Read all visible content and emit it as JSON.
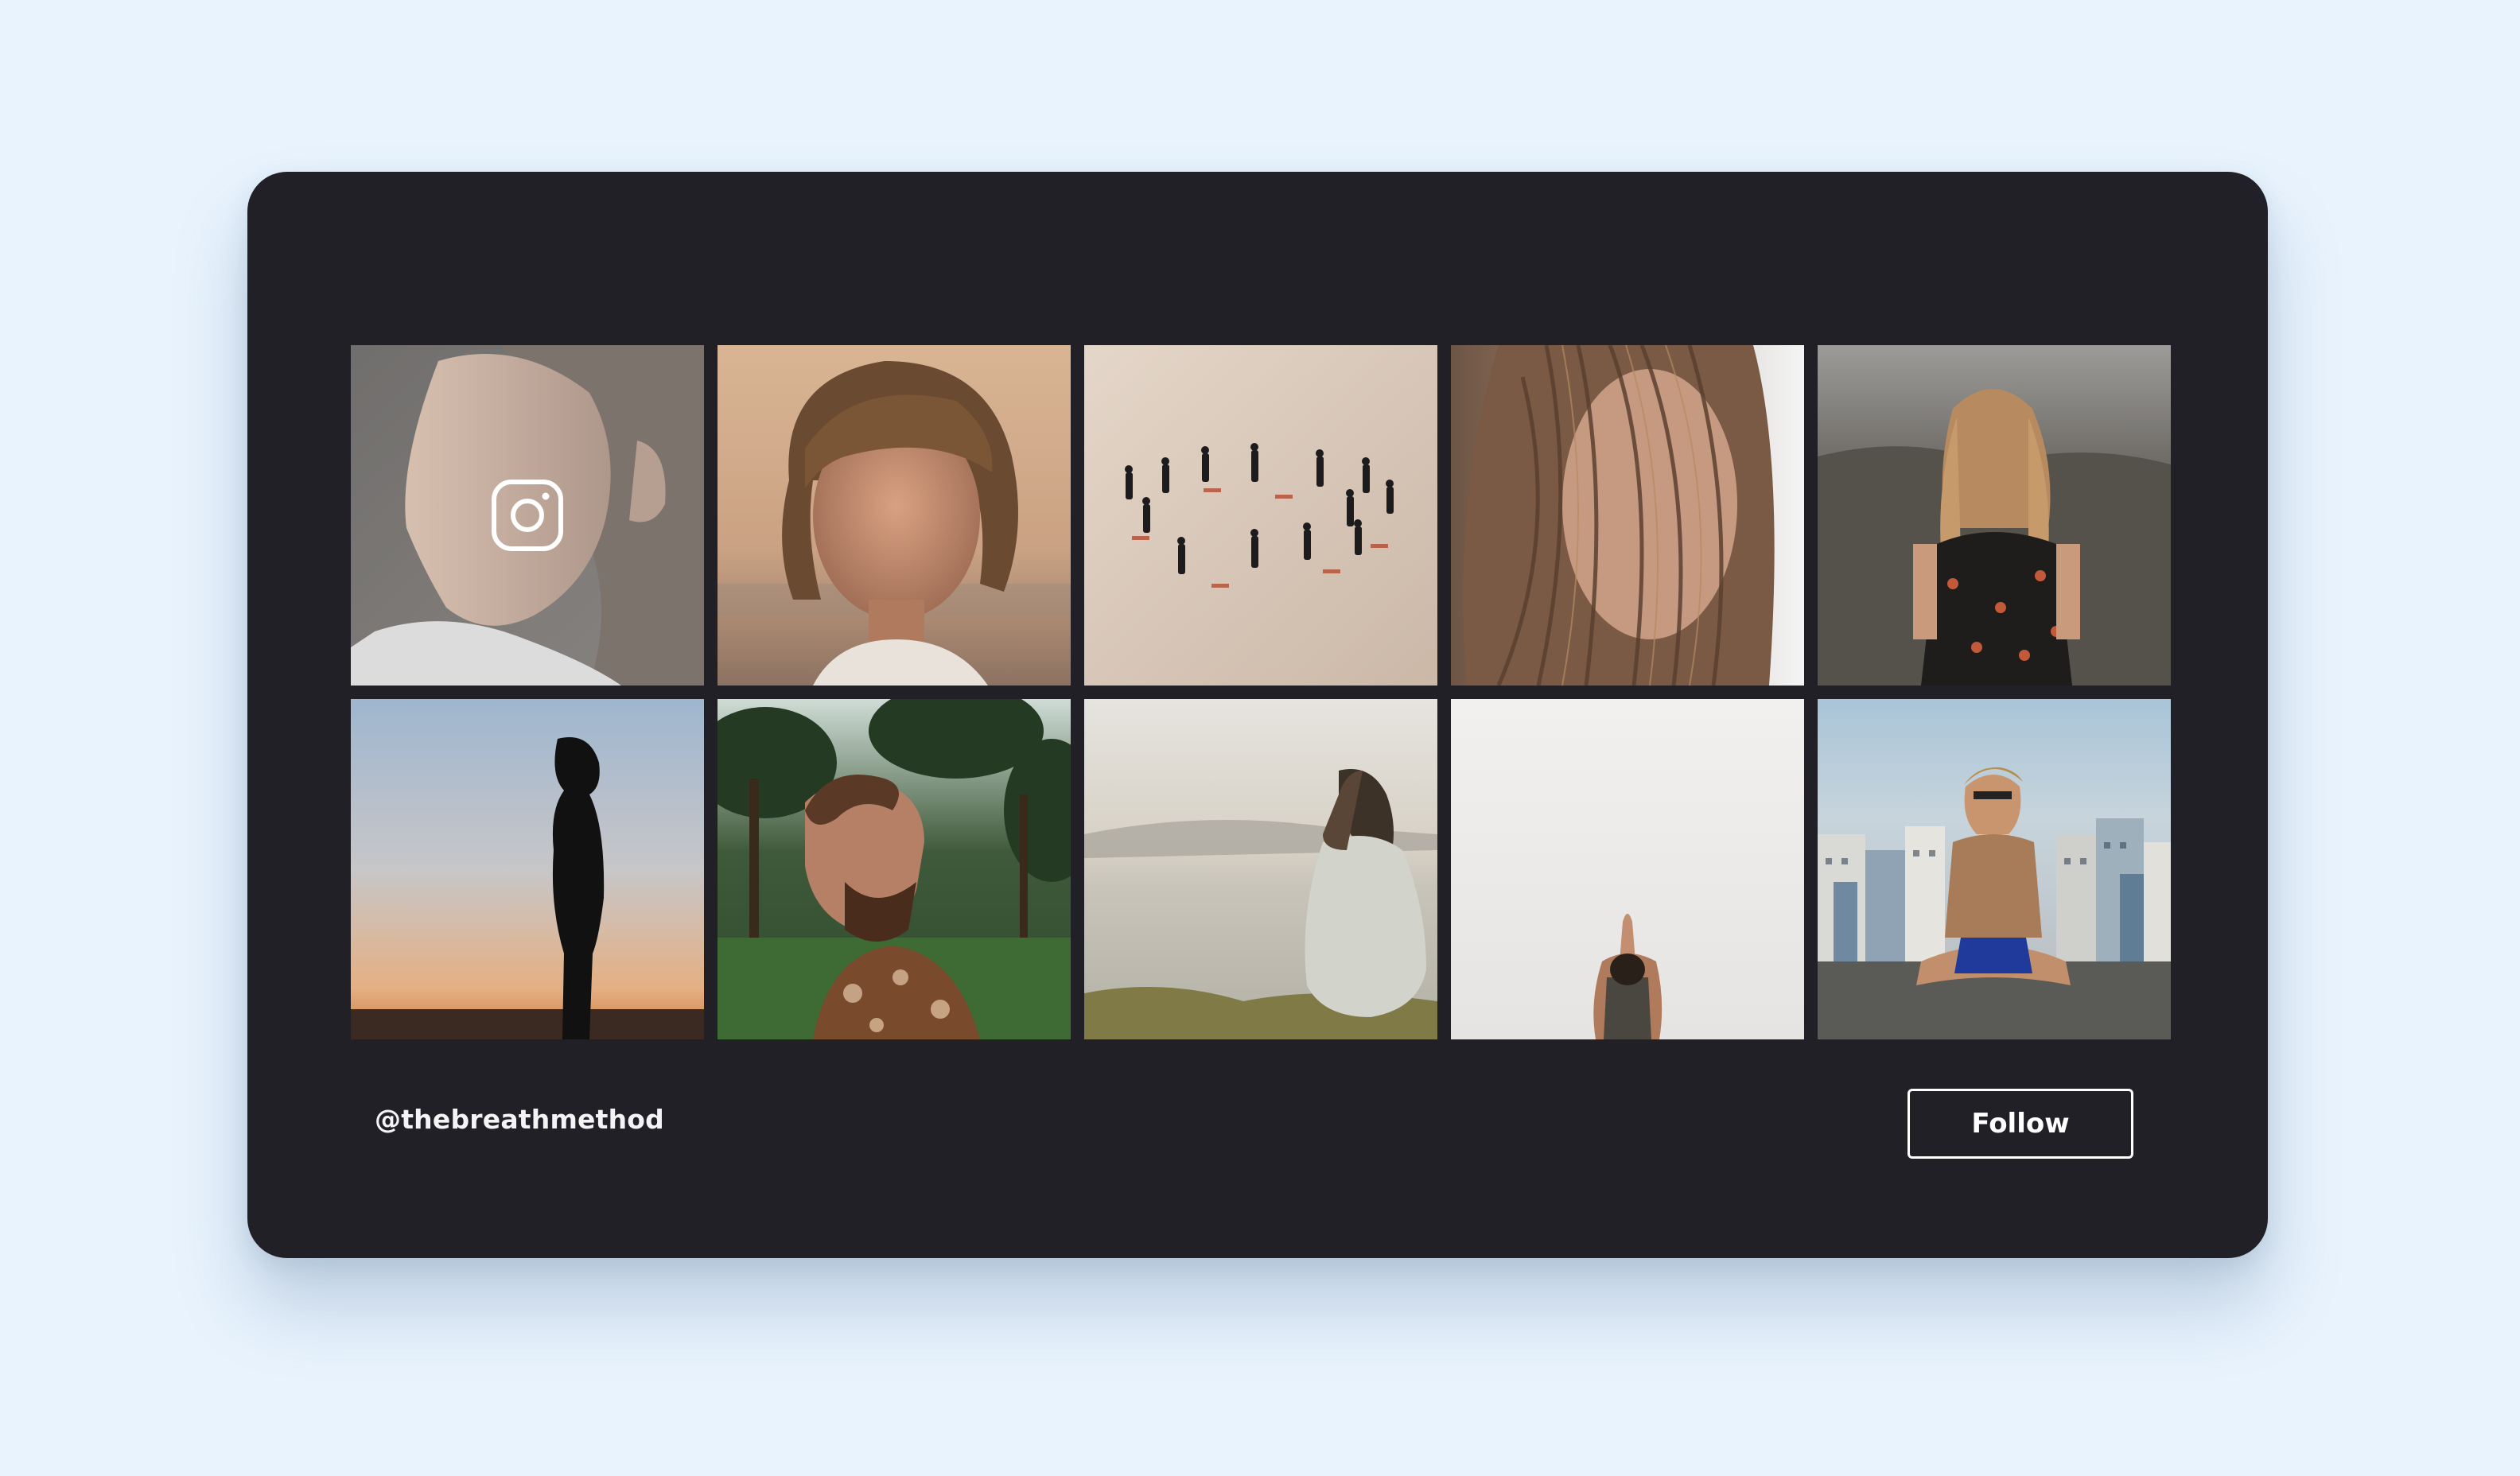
{
  "profile": {
    "handle": "@thebreathmethod",
    "follow_label": "Follow"
  },
  "grid": {
    "tiles": [
      {
        "subject": "woman-profile-eyes-closed",
        "overlay_icon": "instagram-icon"
      },
      {
        "subject": "woman-short-hair-eyes-closed"
      },
      {
        "subject": "group-on-beach"
      },
      {
        "subject": "woman-hair-over-face"
      },
      {
        "subject": "woman-in-floral-dress-from-behind"
      },
      {
        "subject": "silhouette-at-sunset"
      },
      {
        "subject": "bearded-man-in-forest"
      },
      {
        "subject": "woman-sitting-by-sea"
      },
      {
        "subject": "person-hands-raised"
      },
      {
        "subject": "man-meditating-on-rooftop"
      }
    ]
  },
  "colors": {
    "page_background": "#e8f3fd",
    "card_background": "#202026",
    "text": "#ffffff"
  }
}
